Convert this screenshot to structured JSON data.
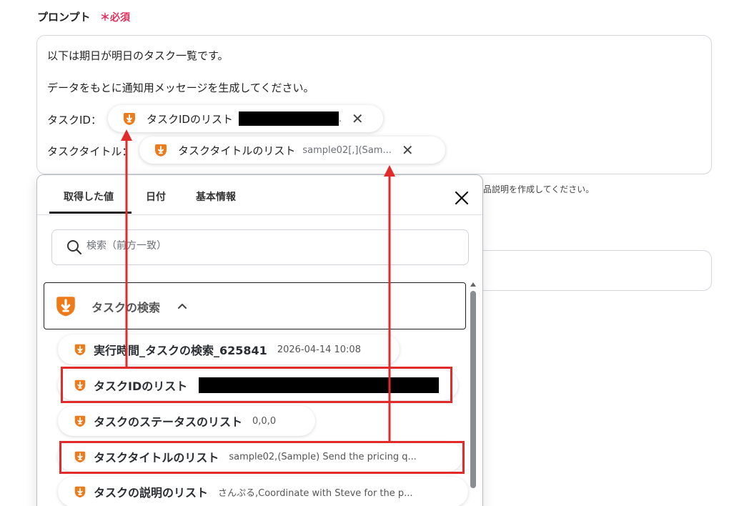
{
  "field": {
    "label": "プロンプト",
    "required_mark": "＊必須"
  },
  "prompt": {
    "line1": "以下は期日が明日のタスク一覧です。",
    "line2": "データをもとに通知用メッセージを生成してください。",
    "line3_label": "タスクID：",
    "line4_label": "タスクタイトル：",
    "chip1": {
      "label": "タスクIDのリスト",
      "value_suffix": ".",
      "close": "✕"
    },
    "chip2": {
      "label": "タスクタイトルのリスト",
      "value": "sample02[,](Sam...",
      "close": "✕"
    }
  },
  "hint_text": "品説明を作成してください。",
  "panel": {
    "tabs": [
      "取得した値",
      "日付",
      "基本情報"
    ],
    "active_tab": "取得した値",
    "search_placeholder": "検索（前方一致）",
    "group": {
      "label": "タスクの検索",
      "expanded": true
    },
    "items": [
      {
        "label": "実行時間_タスクの検索_625841",
        "value": "2026-04-14 10:08"
      },
      {
        "label": "タスクIDのリスト",
        "value": "",
        "redacted": true,
        "highlighted": true
      },
      {
        "label": "タスクのステータスのリスト",
        "value": "0,0,0"
      },
      {
        "label": "タスクタイトルのリスト",
        "value": "sample02,(Sample) Send the pricing q...",
        "highlighted": true
      },
      {
        "label": "タスクの説明のリスト",
        "value": "さんぷる,Coordinate with Steve for the p..."
      }
    ]
  },
  "colors": {
    "accent_orange": "#ef7a1a",
    "required_red": "#e0315d",
    "annotation_red": "#e12a2a"
  },
  "icons": [
    "yoom-output-icon",
    "close-icon",
    "search-icon",
    "chevron-up-icon"
  ]
}
